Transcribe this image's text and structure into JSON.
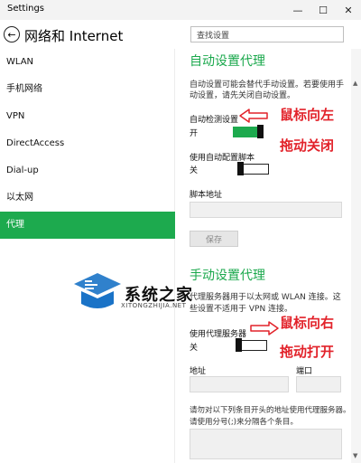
{
  "window": {
    "title": "Settings",
    "controls": [
      "—",
      "☐",
      "✕"
    ]
  },
  "header": {
    "title": "网络和 Internet",
    "search_placeholder": "查找设置"
  },
  "sidebar": {
    "items": [
      {
        "label": "WLAN"
      },
      {
        "label": "手机网络"
      },
      {
        "label": "VPN"
      },
      {
        "label": "DirectAccess"
      },
      {
        "label": "Dial-up"
      },
      {
        "label": "以太网"
      },
      {
        "label": "代理",
        "selected": true
      }
    ]
  },
  "auto_proxy": {
    "heading": "自动设置代理",
    "description_1": "自动设置可能会替代手动设置。若要使用手",
    "description_2": "动设置，请先关闭自动设置。",
    "detect_label": "自动检测设置",
    "detect_state": "开",
    "script_label": "使用自动配置脚本",
    "script_state": "关",
    "address_label": "脚本地址",
    "save_label": "保存"
  },
  "manual_proxy": {
    "heading": "手动设置代理",
    "description_1": "代理服务器用于以太网或 WLAN 连接。这",
    "description_2": "些设置不适用于 VPN 连接。",
    "use_label": "使用代理服务器",
    "use_state": "关",
    "address_label": "地址",
    "port_label": "端口",
    "exceptions_1": "请勿对以下列条目开头的地址使用代理服务器。",
    "exceptions_2": "请使用分号(;)来分隔各个条目。"
  },
  "annotations": {
    "top_1": "鼠标向左",
    "top_2": "拖动关闭",
    "bottom_1": "鼠标向右",
    "bottom_2": "拖动打开"
  },
  "watermark": {
    "cn": "系统之家",
    "en": "XITONGZHIJIA.NET"
  },
  "colors": {
    "accent": "#1daa4e",
    "annotation": "#e2222a",
    "watermark_blue": "#1a73c7"
  }
}
